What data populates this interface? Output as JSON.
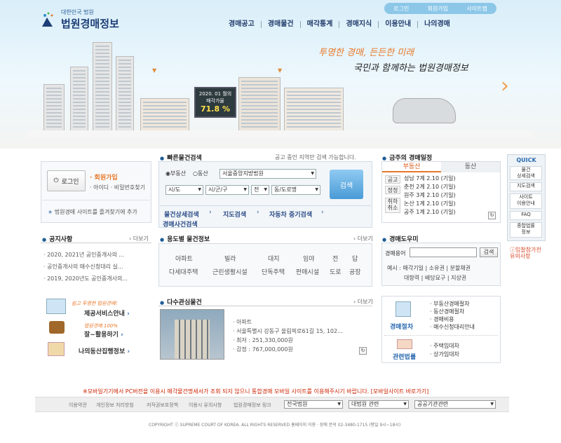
{
  "header": {
    "logo_small": "대한민국 법원",
    "logo_big": "법원경매정보",
    "util": [
      "로그인",
      "회원가입",
      "사이트맵"
    ],
    "gnb": [
      "경매공고",
      "경매물건",
      "매각통계",
      "경매지식",
      "이용안내",
      "나의경매"
    ],
    "slogan1": "투명한 경매, 든든한 미래",
    "slogan2": "국민과 함께하는 법원경매정보",
    "billboard": {
      "line1": "2020. 01 월의",
      "line2": "매각가율",
      "rate": "71.8 %"
    }
  },
  "login": {
    "button": "로그인",
    "join": "· 회원가입",
    "find": "· 아이디 · 비밀번호찾기",
    "favorite": "법원경매 사이트를 즐겨찾기에 추가"
  },
  "quick_search": {
    "title": "빠른물건검색",
    "note": "공고 중인 지역만 검색 가능합니다.",
    "radio1": "부동산",
    "radio2": "동산",
    "court": "서울중앙지방법원",
    "sido": "시/도",
    "sigungu": "시/군/구",
    "jeon": "전",
    "dong": "동/도로명",
    "search": "검색",
    "tabs": [
      "물건상세검색",
      "지도검색",
      "자동차 중기검색",
      "경매사건검색"
    ]
  },
  "schedule": {
    "title": "금주의 경매일정",
    "tab1": "부동산",
    "tab2": "동산",
    "side": [
      "공고",
      "정정",
      "취하\n취소"
    ],
    "items": [
      "성남 7계 2.10 (기일)",
      "춘천 2계 2.10 (기일)",
      "원주 3계 2.10 (기일)",
      "논산 1계 2.10 (기일)",
      "공주 1계 2.10 (기일)"
    ]
  },
  "quick": {
    "title": "QUICK",
    "items": [
      "물건\n상세검색",
      "지도검색",
      "사이트\n이용안내",
      "FAQ",
      "종합법률\n정보"
    ],
    "notice": "입찰참가전\n유의사항"
  },
  "notices": {
    "title": "공지사항",
    "more": "› 더보기",
    "items": [
      "2020, 2021년 공인중개사의 ...",
      "공인중개사의 매수신청대리 실...",
      "2019, 2020년도 공인중개사의..."
    ]
  },
  "usage": {
    "title": "용도별 물건정보",
    "more": "› 더보기",
    "row1": [
      "아파트",
      "빌라",
      "대지",
      "임야",
      "전",
      "답"
    ],
    "row2": [
      "다세대주택",
      "근린생활시설",
      "단독주택",
      "판매시설",
      "도로",
      "공장"
    ]
  },
  "dictionary": {
    "title": "경매도우미",
    "label": "경매용어",
    "search": "검색",
    "ex1": "예시 :  매각기일 |  소유권 |  분할채권",
    "ex2": "대항력 |  배당요구 |  지상권"
  },
  "services": [
    {
      "tag": "쉽고 투명한 법원경매!",
      "label": "제공서비스안내"
    },
    {
      "tag": "법원경매 100% ",
      "label": "잘~활용하기"
    },
    {
      "tag": "",
      "label": "나의동산집행정보"
    }
  ],
  "interest": {
    "title": "다수관심물건",
    "more": "› 더보기",
    "type": "· 아파트",
    "addr": "· 서울특별시 강동구 올림픽로61길 15, 102...",
    "min": "· 최저 : 251,330,000원",
    "appr": "· 감정 : 767,000,000원"
  },
  "guide": {
    "procedure_label": "경매절차",
    "procedure_items": [
      "부동산경매절차",
      "동산경매절차",
      "경매비용",
      "매수신청대리안내"
    ],
    "law_label": "관련법률",
    "law_items": [
      "주택임대차",
      "상가임대차"
    ]
  },
  "mobile_notice": "※모바일기기에서 PC버전을 이용시 매각물건명세서가 조회 되지 않으니 통합경매 모바일 사이트를 이용해주시기 바랍니다.  [모바일사이트 바로가기]",
  "footer": {
    "links": [
      "이용약관",
      "개인정보 처리방침",
      "저작권보호정책",
      "이용시 유의사항",
      "법원경매정보 링크"
    ],
    "sel1": "전국법원",
    "sel2": "대법원 관련",
    "sel3": "공공기관관련",
    "copyright": "COPYRIGHT ⓒ  SUPREME COURT OF KOREA. ALL RIGHTS RESERVED    홈페이지 이용 · 장애 문의 02-3480-1715 (평일 9시~18시)"
  },
  "colors": {
    "accent": "#1f5e97",
    "orange": "#e87a2a",
    "notice_red": "#cc2200"
  }
}
